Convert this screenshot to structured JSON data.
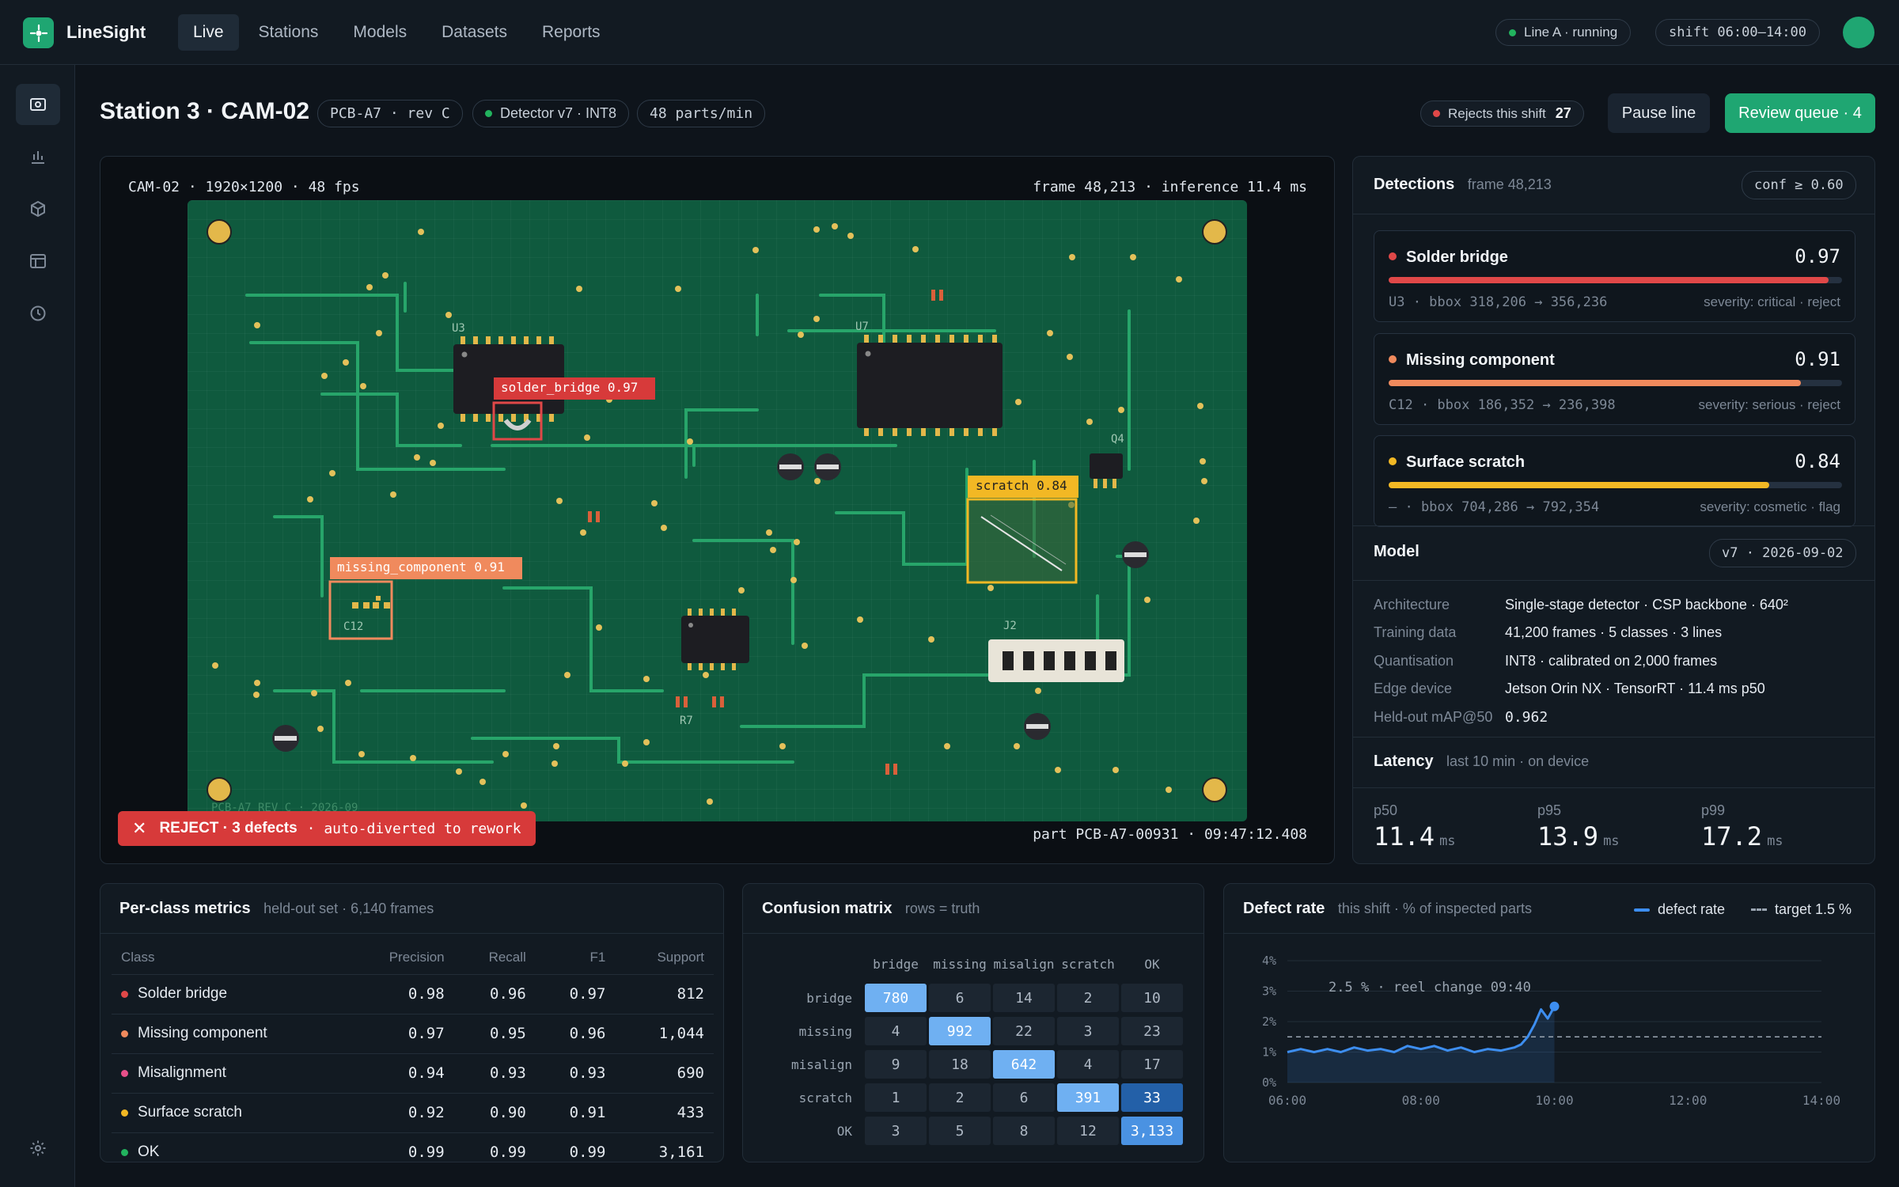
{
  "app": {
    "name": "LineSight",
    "status": "Line A · running",
    "shift": "shift 06:00–14:00"
  },
  "nav": [
    "Live",
    "Stations",
    "Models",
    "Datasets",
    "Reports"
  ],
  "station": {
    "title": "Station 3 · CAM-02",
    "part_chip": "PCB-A7 · rev C",
    "detector_chip": "Detector v7 · INT8",
    "rate_chip": "48 parts/min",
    "rejects_label": "Rejects this shift",
    "rejects_count": "27",
    "pause_label": "Pause line",
    "review_label": "Review queue · 4"
  },
  "camera": {
    "info_left": "CAM-02 · 1920×1200 · 48 fps",
    "info_right": "frame 48,213 · inference 11.4 ms",
    "part_info": "part PCB-A7-00931 · 09:47:12.408",
    "board_text": "PCB-A7 REV C · 2026-09",
    "labels": {
      "u3": "U3",
      "u7": "U7",
      "q4": "Q4",
      "c12": "C12",
      "j2": "J2",
      "r7": "R7"
    },
    "box_bridge": "solder_bridge 0.97",
    "box_missing": "missing_component 0.91",
    "box_scratch": "scratch 0.84",
    "reject_title": "REJECT · 3 defects",
    "reject_sub": "· auto-diverted to rework"
  },
  "detections": {
    "title": "Detections",
    "frame": "frame 48,213",
    "conf": "conf ≥ 0.60",
    "items": [
      {
        "name": "Solder bridge",
        "score": "0.97",
        "score_value": 0.97,
        "meta": "U3 · bbox 318,206 → 356,236",
        "severity": "severity: critical · reject",
        "color": "#e04848"
      },
      {
        "name": "Missing component",
        "score": "0.91",
        "score_value": 0.91,
        "meta": "C12 · bbox 186,352 → 236,398",
        "severity": "severity: serious · reject",
        "color": "#f08a5d"
      },
      {
        "name": "Surface scratch",
        "score": "0.84",
        "score_value": 0.84,
        "meta": "— · bbox 704,286 → 792,354",
        "severity": "severity: cosmetic · flag",
        "color": "#f2b824"
      }
    ]
  },
  "model": {
    "title": "Model",
    "version": "v7 · 2026-09-02",
    "rows": [
      {
        "key": "Architecture",
        "value": "Single-stage detector · CSP backbone · 640²"
      },
      {
        "key": "Training data",
        "value": "41,200 frames · 5 classes · 3 lines"
      },
      {
        "key": "Quantisation",
        "value": "INT8 · calibrated on 2,000 frames"
      },
      {
        "key": "Edge device",
        "value": "Jetson Orin NX · TensorRT · 11.4 ms p50"
      },
      {
        "key": "Held-out mAP@50",
        "value": "0.962"
      }
    ]
  },
  "latency": {
    "title": "Latency",
    "sub": "last 10 min · on device",
    "items": [
      {
        "label": "p50",
        "value": "11.4",
        "unit": "ms"
      },
      {
        "label": "p95",
        "value": "13.9",
        "unit": "ms"
      },
      {
        "label": "p99",
        "value": "17.2",
        "unit": "ms"
      }
    ]
  },
  "metrics": {
    "title": "Per-class metrics",
    "sub": "held-out set · 6,140 frames",
    "headers": [
      "Class",
      "Precision",
      "Recall",
      "F1",
      "Support"
    ],
    "rows": [
      {
        "cls": "Solder bridge",
        "p": "0.98",
        "r": "0.96",
        "f1": "0.97",
        "s": "812",
        "color": "#e04848"
      },
      {
        "cls": "Missing component",
        "p": "0.97",
        "r": "0.95",
        "f1": "0.96",
        "s": "1,044",
        "color": "#f08a5d"
      },
      {
        "cls": "Misalignment",
        "p": "0.94",
        "r": "0.93",
        "f1": "0.93",
        "s": "690",
        "color": "#e8508a"
      },
      {
        "cls": "Surface scratch",
        "p": "0.92",
        "r": "0.90",
        "f1": "0.91",
        "s": "433",
        "color": "#f2b824"
      },
      {
        "cls": "OK",
        "p": "0.99",
        "r": "0.99",
        "f1": "0.99",
        "s": "3,161",
        "color": "#22b35e"
      }
    ]
  },
  "confusion": {
    "title": "Confusion matrix",
    "sub": "rows = truth",
    "cols": [
      "bridge",
      "missing",
      "misalign",
      "scratch",
      "OK"
    ],
    "rows": [
      "bridge",
      "missing",
      "misalign",
      "scratch",
      "OK"
    ],
    "values": [
      [
        "780",
        "6",
        "14",
        "2",
        "10"
      ],
      [
        "4",
        "992",
        "22",
        "3",
        "23"
      ],
      [
        "9",
        "18",
        "642",
        "4",
        "17"
      ],
      [
        "1",
        "2",
        "6",
        "391",
        "33"
      ],
      [
        "3",
        "5",
        "8",
        "12",
        "3,133"
      ]
    ]
  },
  "defect_rate": {
    "title": "Defect rate",
    "sub": "this shift · % of inspected parts",
    "legend_rate": "defect rate",
    "legend_target": "target 1.5 %",
    "annotation": "2.5 % · reel change 09:40"
  },
  "chart_data": {
    "type": "line",
    "title": "Defect rate",
    "xlabel": "",
    "ylabel": "",
    "x_ticks": [
      "06:00",
      "08:00",
      "10:00",
      "12:00",
      "14:00"
    ],
    "y_ticks": [
      "0%",
      "1%",
      "2%",
      "3%",
      "4%"
    ],
    "xlim": [
      6,
      14
    ],
    "ylim": [
      0,
      4
    ],
    "grid": true,
    "legend": "top-right",
    "target": 1.5,
    "series": [
      {
        "name": "defect rate",
        "x": [
          6.0,
          6.2,
          6.4,
          6.6,
          6.8,
          7.0,
          7.2,
          7.4,
          7.6,
          7.8,
          8.0,
          8.2,
          8.4,
          8.6,
          8.8,
          9.0,
          9.2,
          9.4,
          9.5,
          9.6,
          9.7,
          9.8,
          9.9,
          10.0
        ],
        "y": [
          1.0,
          1.1,
          1.0,
          1.1,
          1.0,
          1.15,
          1.05,
          1.1,
          1.0,
          1.2,
          1.1,
          1.2,
          1.05,
          1.15,
          1.0,
          1.1,
          1.05,
          1.15,
          1.25,
          1.5,
          1.9,
          2.4,
          2.1,
          2.5
        ]
      }
    ]
  }
}
